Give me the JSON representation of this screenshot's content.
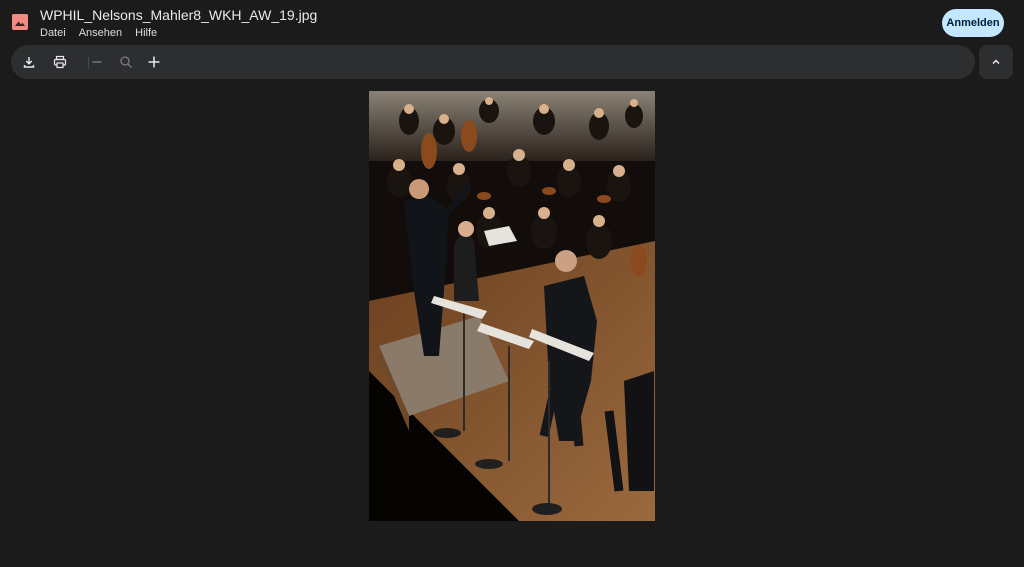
{
  "window": {
    "file_name": "WPHIL_Nelsons_Mahler8_WKH_AW_19.jpg"
  },
  "menu": [
    "Datei",
    "Ansehen",
    "Hilfe"
  ],
  "account": {
    "sign_in_label": "Anmelden"
  },
  "toolbar": {
    "icons": [
      "download-icon",
      "print-icon",
      "zoom-out-icon",
      "zoom-reset-icon",
      "zoom-in-icon"
    ],
    "collapse_icon": "chevron-up-icon"
  },
  "colors": {
    "background": "#1b1b1b",
    "toolbar": "#2d2e30",
    "accent_button": "#c2e7ff",
    "file_icon": "#f28b82"
  },
  "image": {
    "content": "photo-orchestra-concert"
  }
}
